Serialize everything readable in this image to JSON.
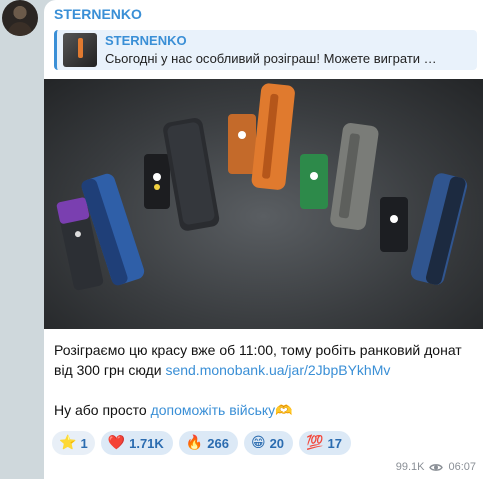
{
  "message": {
    "channel_name": "STERNENKO",
    "reply": {
      "title": "STERNENKO",
      "text": "Сьогодні у нас особливий розіграш! Можете виграти …"
    },
    "body_line1": "Розіграємо цю красу вже об 11:00, тому робіть ранковий донат",
    "body_line2_prefix": "від 300 грн сюди ",
    "body_link": "send.monobank.ua/jar/2JbpBYkhMv",
    "body_line3_prefix": "Ну або просто ",
    "body_link2": "допоможіть війську",
    "body_emoji": "🫶"
  },
  "reactions": [
    {
      "emoji": "⭐",
      "count": "1"
    },
    {
      "emoji": "❤️",
      "count": "1.71K"
    },
    {
      "emoji": "🔥",
      "count": "266"
    },
    {
      "emoji": "😁",
      "count": "20"
    },
    {
      "emoji": "💯",
      "count": "17"
    }
  ],
  "meta": {
    "views": "99.1K",
    "time": "06:07"
  },
  "colors": {
    "accent": "#3a8fd6",
    "reaction_bg": "#dce9f6"
  },
  "icons": {
    "views": "eye-icon"
  }
}
